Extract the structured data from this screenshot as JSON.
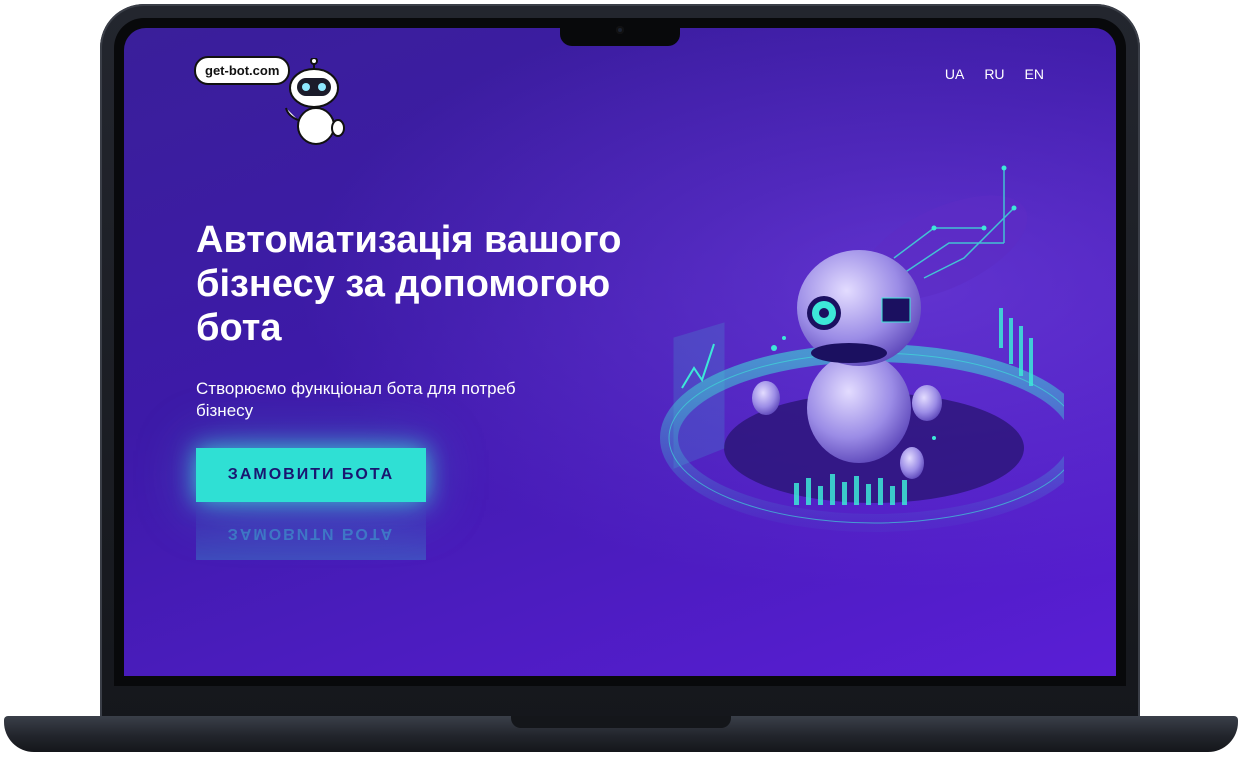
{
  "logo": {
    "text": "get-bot.com"
  },
  "languages": [
    "UA",
    "RU",
    "EN"
  ],
  "hero": {
    "title": "Автоматизація вашого бізнесу за допомогою бота",
    "subtitle": "Створюємо функціонал бота для потреб бізнесу",
    "cta_label": "ЗАМОВИТИ БОТА"
  },
  "colors": {
    "background_start": "#3a1f9a",
    "background_end": "#5a1ed6",
    "accent": "#2fe0d4",
    "cta_text": "#1a1670"
  },
  "icons": {
    "logo": "robot-icon",
    "illustration": "robot-icon"
  }
}
